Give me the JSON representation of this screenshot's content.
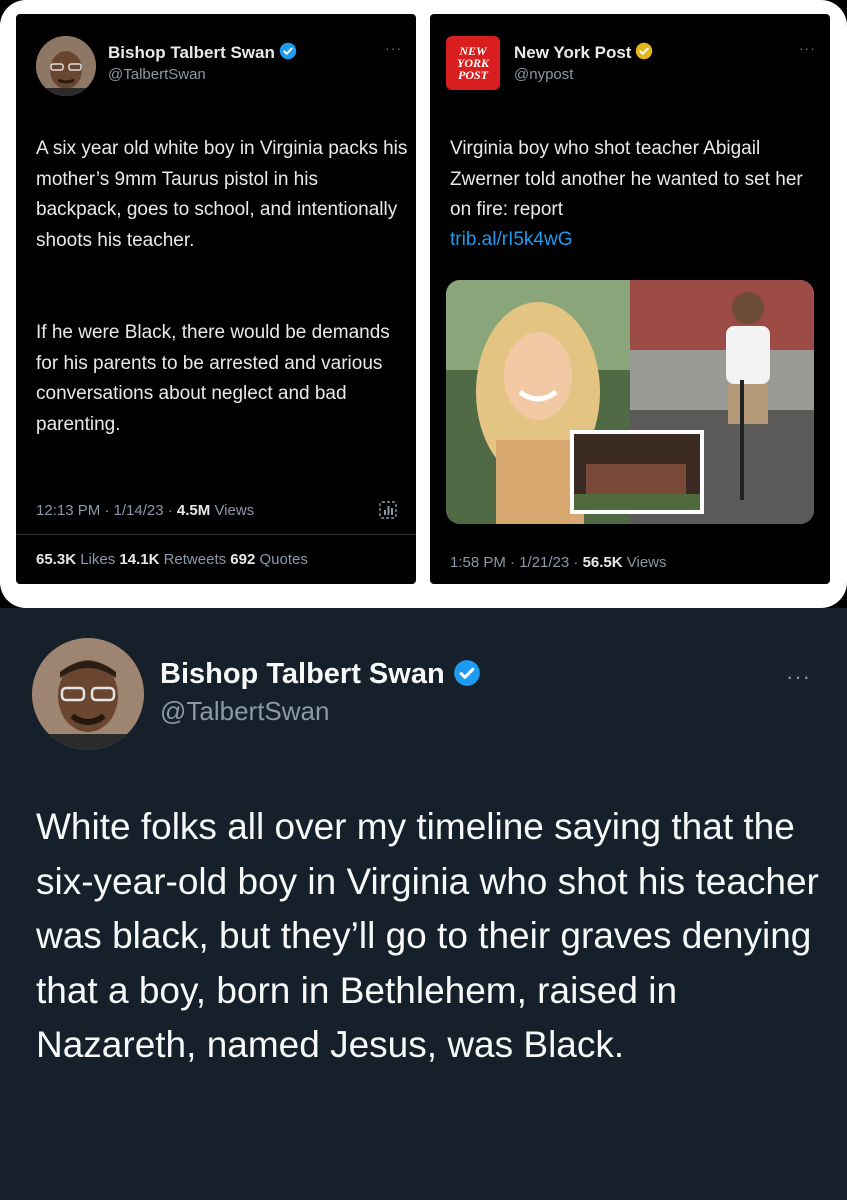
{
  "left_tweet": {
    "author_name": "Bishop Talbert Swan",
    "author_handle": "@TalbertSwan",
    "more": "···",
    "paragraph_1": "A six year old white boy in Virginia packs his mother’s 9mm Taurus pistol in his backpack, goes to school, and intentionally shoots his teacher.",
    "paragraph_2": "If he were Black, there would be demands for his parents to be arrested and various conversations about neglect and bad parenting.",
    "time": "12:13 PM · 1/14/23 · ",
    "views_count": "4.5M",
    "views_label": " Views",
    "likes_count": "65.3K",
    "likes_label": " Likes ",
    "retweets_count": "14.1K",
    "retweets_label": " Retweets ",
    "quotes_count": "692",
    "quotes_label": " Quotes"
  },
  "right_tweet": {
    "logo_lines": [
      "NEW",
      "YORK",
      "POST"
    ],
    "author_name": "New York Post",
    "author_handle": "@nypost",
    "more": "···",
    "text": "Virginia boy who shot teacher Abigail Zwerner told another he wanted to set her on fire: report",
    "link": "trib.al/rI5k4wG",
    "time": "1:58 PM · 1/21/23 · ",
    "views_count": "56.5K",
    "views_label": " Views"
  },
  "bottom_tweet": {
    "author_name": "Bishop Talbert Swan",
    "author_handle": "@TalbertSwan",
    "more": "···",
    "text": "White folks all over my timeline saying that the six-year-old boy in Virginia who shot his teacher was black, but they’ll go to their graves denying that a boy, born in Bethlehem, raised in Nazareth, named Jesus, was Black."
  },
  "colors": {
    "tweet_bg_dark": "#000000",
    "tweet_bg_dim": "#15202b",
    "text_primary": "#e7e9ea",
    "text_secondary": "#8b98a5",
    "verified_blue": "#1d9bf0",
    "verified_gold": "#e2b719",
    "nyp_red": "#d81e1e"
  },
  "icons": [
    "verified-badge-icon",
    "more-options-icon",
    "analytics-icon"
  ]
}
